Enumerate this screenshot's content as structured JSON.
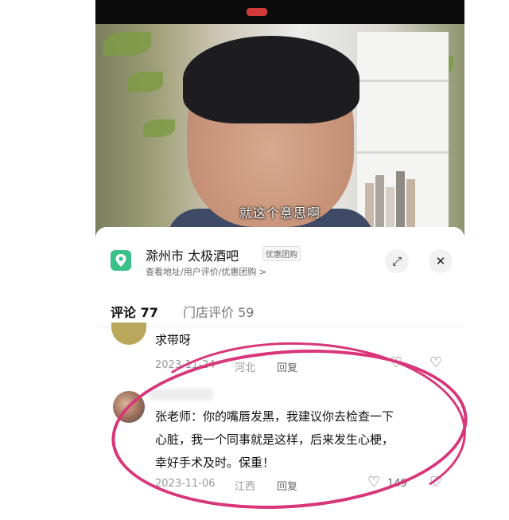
{
  "video": {
    "subtitle": "就这个意思啊"
  },
  "location": {
    "name": "滁州市  太极酒吧",
    "badge": "优惠团购",
    "subtitle": "查看地址/用户评价/优惠团购 >",
    "expand_icon": "expand-icon",
    "close_icon": "close-icon",
    "accent_color": "#3cc08a"
  },
  "tabs": [
    {
      "label": "评论 77"
    },
    {
      "label": "门店评价 59"
    }
  ],
  "comments": [
    {
      "text": "求带呀",
      "date": "2023-11-24",
      "region": "河北",
      "reply": "回复"
    },
    {
      "text_lines": [
        "张老师：你的嘴唇发黑，我建议你去检查一下",
        "心脏，我一个同事就是这样，后来发生心梗，",
        "幸好手术及时。保重！"
      ],
      "date": "2023-11-06",
      "region": "江西",
      "reply": "回复",
      "likes": "149"
    }
  ],
  "annotation_color": "#d8357a"
}
